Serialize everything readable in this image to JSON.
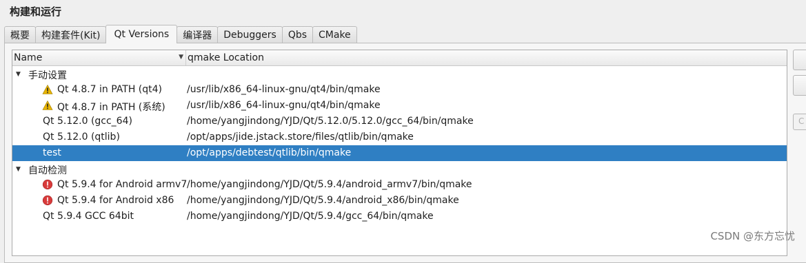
{
  "section_title": "构建和运行",
  "tabs": [
    "概要",
    "构建套件(Kit)",
    "Qt Versions",
    "编译器",
    "Debuggers",
    "Qbs",
    "CMake"
  ],
  "active_tab": "Qt Versions",
  "columns": {
    "name": "Name",
    "location": "qmake Location"
  },
  "groups": [
    {
      "label": "手动设置",
      "items": [
        {
          "name": "Qt 4.8.7 in PATH (qt4)",
          "location": "/usr/lib/x86_64-linux-gnu/qt4/bin/qmake",
          "icon": "warning-icon"
        },
        {
          "name": "Qt 4.8.7 in PATH (系统)",
          "location": "/usr/lib/x86_64-linux-gnu/qt4/bin/qmake",
          "icon": "warning-icon"
        },
        {
          "name": "Qt 5.12.0 (gcc_64)",
          "location": "/home/yangjindong/YJD/Qt/5.12.0/5.12.0/gcc_64/bin/qmake",
          "icon": ""
        },
        {
          "name": "Qt 5.12.0 (qtlib)",
          "location": "/opt/apps/jide.jstack.store/files/qtlib/bin/qmake",
          "icon": ""
        },
        {
          "name": "test",
          "location": "/opt/apps/debtest/qtlib/bin/qmake",
          "icon": "",
          "selected": true
        }
      ]
    },
    {
      "label": "自动检测",
      "items": [
        {
          "name": "Qt 5.9.4 for Android armv7",
          "location": "/home/yangjindong/YJD/Qt/5.9.4/android_armv7/bin/qmake",
          "icon": "error-icon"
        },
        {
          "name": "Qt 5.9.4 for Android x86",
          "location": "/home/yangjindong/YJD/Qt/5.9.4/android_x86/bin/qmake",
          "icon": "error-icon"
        },
        {
          "name": "Qt 5.9.4 GCC 64bit",
          "location": "/home/yangjindong/YJD/Qt/5.9.4/gcc_64/bin/qmake",
          "icon": ""
        }
      ]
    }
  ],
  "side_button_partial_label": "C",
  "watermark": "CSDN @东方忘忧",
  "colors": {
    "selection": "#2f7fc3",
    "warning": "#e8b400",
    "error": "#d83b3b"
  }
}
